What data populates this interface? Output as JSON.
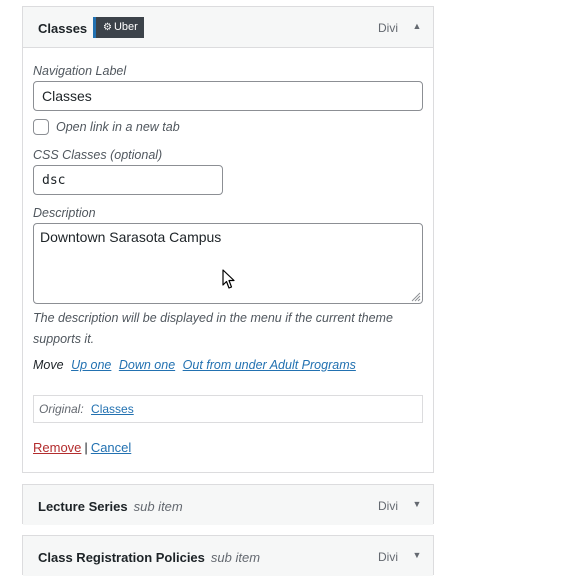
{
  "main_item": {
    "title": "Classes",
    "badge": {
      "icon": "gear-icon",
      "label": "Uber"
    },
    "type_label": "Divi",
    "toggle_icon": "arrow-up-icon",
    "fields": {
      "navigation_label": {
        "label": "Navigation Label",
        "value": "Classes"
      },
      "new_tab": {
        "label": "Open link in a new tab",
        "checked": false
      },
      "css_classes": {
        "label": "CSS Classes (optional)",
        "value": "dsc"
      },
      "description": {
        "label": "Description",
        "value": "Downtown Sarasota Campus",
        "help": "The description will be displayed in the menu if the current theme supports it."
      }
    },
    "move": {
      "label": "Move",
      "links": [
        "Up one",
        "Down one",
        "Out from under Adult Programs"
      ]
    },
    "original": {
      "label": "Original:",
      "link": "Classes"
    },
    "actions": {
      "remove": "Remove",
      "separator": "|",
      "cancel": "Cancel"
    }
  },
  "sub_items": [
    {
      "title": "Lecture Series",
      "sub_label": "sub item",
      "type_label": "Divi",
      "toggle_icon": "arrow-down-icon"
    },
    {
      "title": "Class Registration Policies",
      "sub_label": "sub item",
      "type_label": "Divi",
      "toggle_icon": "arrow-down-icon"
    }
  ],
  "colors": {
    "link": "#2271b1",
    "remove_link": "#b32d2e",
    "badge_bg": "#3c434a",
    "badge_accent": "#2271b1",
    "header_bg": "#f6f7f7"
  }
}
